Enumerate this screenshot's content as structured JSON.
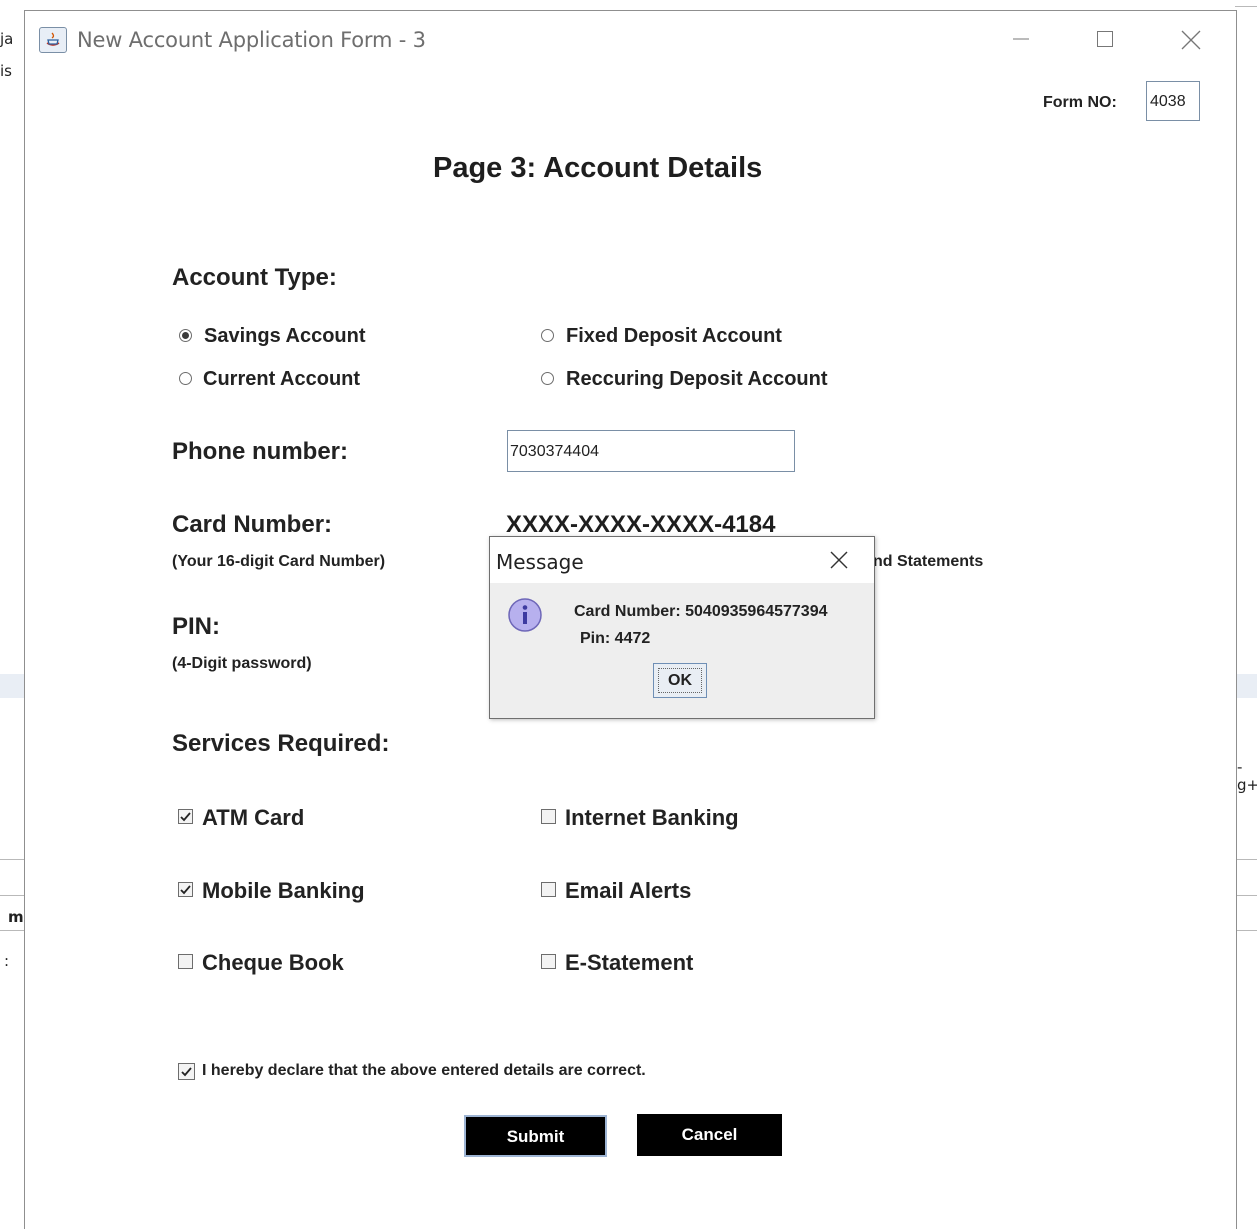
{
  "background": {
    "fragments": [
      "ja",
      "is",
      "m",
      ":",
      "-g+"
    ]
  },
  "window": {
    "title": "New Account Application Form - 3",
    "controls": {
      "minimize": "minimize-icon",
      "maximize": "maximize-icon",
      "close": "close-icon"
    }
  },
  "form_no": {
    "label": "Form NO:",
    "value": "4038"
  },
  "page_title": "Page 3: Account Details",
  "account_type": {
    "heading": "Account Type:",
    "options": [
      {
        "label": "Savings Account",
        "selected": true
      },
      {
        "label": "Fixed Deposit Account",
        "selected": false
      },
      {
        "label": "Current Account",
        "selected": false
      },
      {
        "label": "Reccuring Deposit Account",
        "selected": false
      }
    ]
  },
  "phone": {
    "label": "Phone number:",
    "value": "7030374404"
  },
  "card": {
    "label": "Card Number:",
    "note": "(Your 16-digit Card Number)",
    "masked": "XXXX-XXXX-XXXX-4184",
    "partial_note": "nd Statements"
  },
  "pin": {
    "label": "PIN:",
    "note": "(4-Digit password)"
  },
  "services": {
    "heading": "Services Required:",
    "items": [
      {
        "label": "ATM Card",
        "checked": true
      },
      {
        "label": "Internet Banking",
        "checked": false
      },
      {
        "label": "Mobile Banking",
        "checked": true
      },
      {
        "label": "Email Alerts",
        "checked": false
      },
      {
        "label": "Cheque Book",
        "checked": false
      },
      {
        "label": "E-Statement",
        "checked": false
      }
    ]
  },
  "declaration": {
    "label": "I hereby declare that the above entered details are correct.",
    "checked": true
  },
  "buttons": {
    "submit": "Submit",
    "cancel": "Cancel"
  },
  "dialog": {
    "title": "Message",
    "line1": "Card Number: 5040935964577394",
    "line2": "Pin: 4472",
    "ok": "OK",
    "icon": "info-icon"
  },
  "colors": {
    "accent_border": "#9db4d3",
    "button_bg": "#000000",
    "dialog_bg": "#eeeeee",
    "info_icon": "#a9a2e6"
  }
}
